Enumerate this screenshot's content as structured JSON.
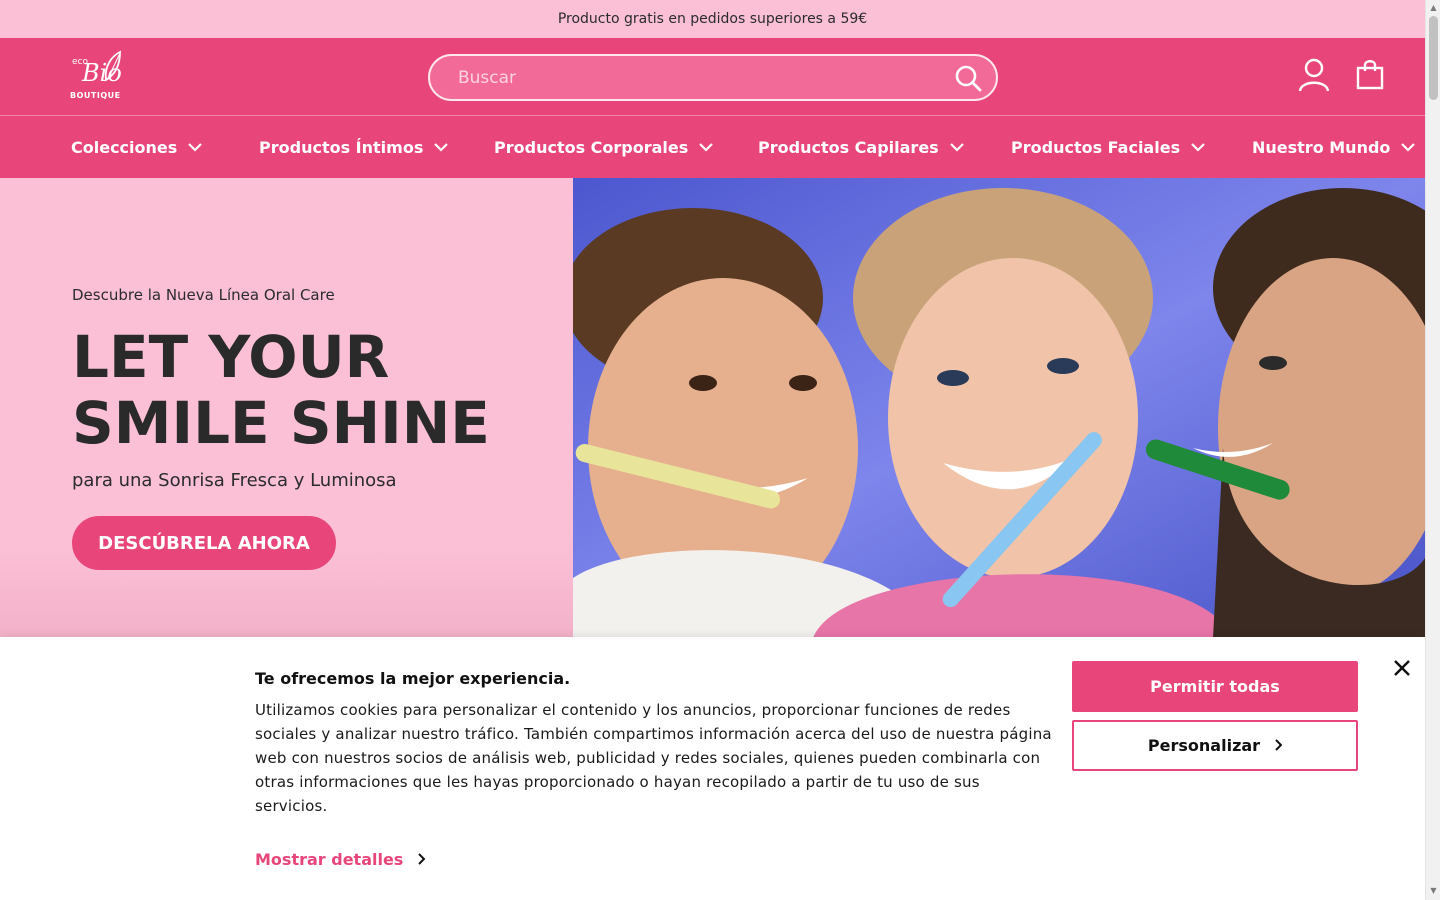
{
  "announcement": {
    "text": "Producto gratis en pedidos superiores a 59€"
  },
  "header": {
    "logo": {
      "alt_text": "eco Bio BOUTIQUE",
      "script_mark": "Bio",
      "small_mark": "eco",
      "bottom_text": "BOUTIQUE"
    },
    "search": {
      "placeholder": "Buscar",
      "value": ""
    },
    "icons": {
      "search": "search-icon",
      "account": "user-icon",
      "cart": "shopping-bag-icon"
    }
  },
  "nav": {
    "items": [
      {
        "label": "Colecciones"
      },
      {
        "label": "Productos Íntimos"
      },
      {
        "label": "Productos Corporales"
      },
      {
        "label": "Productos Capilares"
      },
      {
        "label": "Productos Faciales"
      },
      {
        "label": "Nuestro Mundo"
      }
    ]
  },
  "hero": {
    "kicker": "Descubre la Nueva Línea Oral Care",
    "title_line1": "LET YOUR",
    "title_line2": "SMILE SHINE",
    "subtitle": "para una Sonrisa Fresca y Luminosa",
    "cta": "DESCÚBRELA AHORA"
  },
  "cookie_banner": {
    "title": "Te ofrecemos la mejor experiencia.",
    "body": "Utilizamos cookies para personalizar el contenido y los anuncios, proporcionar funciones de redes sociales y analizar nuestro tráfico. También compartimos información acerca del uso de nuestra página web con nuestros socios de análisis web, publicidad y redes sociales, quienes pueden combinarla con otras informaciones que les hayas proporcionado o hayan recopilado a partir de tu uso de sus servicios.",
    "details_link": "Mostrar detalles",
    "allow_all": "Permitir todas",
    "customize": "Personalizar"
  },
  "colors": {
    "brand_pink": "#e8467b",
    "light_pink": "#fbc0d6",
    "hero_backdrop_blue": "#5a63d8"
  }
}
